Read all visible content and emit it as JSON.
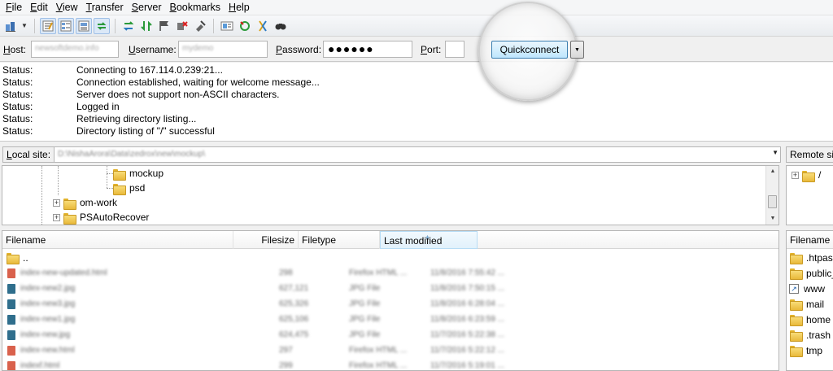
{
  "menu": [
    "File",
    "Edit",
    "View",
    "Transfer",
    "Server",
    "Bookmarks",
    "Help"
  ],
  "menu_accel": [
    "F",
    "E",
    "V",
    "T",
    "S",
    "B",
    "H"
  ],
  "menu_rest": [
    "ile",
    "dit",
    "iew",
    "ransfer",
    "erver",
    "ookmarks",
    "elp"
  ],
  "toolbar": {
    "icons": [
      "site-manager-icon",
      "toggle-message-log-icon",
      "toggle-local-tree-icon",
      "toggle-remote-tree-icon",
      "toggle-transfer-queue-icon",
      "refresh-icon",
      "process-queue-icon",
      "cancel-operation-icon",
      "disconnect-icon",
      "reconnect-icon",
      "directory-filter-icon",
      "sync-browsing-icon",
      "compare-dirs-icon",
      "search-icon"
    ]
  },
  "quickconnect": {
    "host_label_acc": "H",
    "host_label_rest": "ost:",
    "host_value": "newsoftdemo.info",
    "username_label_acc": "U",
    "username_label_rest": "sername:",
    "username_value": "mydemo",
    "password_label_acc": "P",
    "password_label_rest": "assword:",
    "password_value": "●●●●●●",
    "port_label_acc": "P",
    "port_label_rest": "ort:",
    "port_value": "",
    "button_label": "Quickconnect"
  },
  "log": [
    {
      "type": "Status:",
      "msg": "Connecting to 167.114.0.239:21..."
    },
    {
      "type": "Status:",
      "msg": "Connection established, waiting for welcome message..."
    },
    {
      "type": "Status:",
      "msg": "Server does not support non-ASCII characters."
    },
    {
      "type": "Status:",
      "msg": "Logged in"
    },
    {
      "type": "Status:",
      "msg": "Retrieving directory listing..."
    },
    {
      "type": "Status:",
      "msg": "Directory listing of \"/\" successful"
    }
  ],
  "local": {
    "label_acc": "L",
    "label_rest": "ocal site:",
    "path": "D:\\NishaArora\\Data\\zedrox\\new\\mockup\\",
    "tree": [
      "mockup",
      "psd",
      "om-work",
      "PSAutoRecover"
    ]
  },
  "remote": {
    "label": "Remote si",
    "tree_root": "/",
    "filename_header": "Filename",
    "files": [
      ".htpass",
      "public_",
      "www",
      "mail",
      "home",
      ".trash",
      "tmp"
    ]
  },
  "filelist": {
    "headers": {
      "filename": "Filename",
      "filesize": "Filesize",
      "filetype": "Filetype",
      "modified": "Last modified"
    },
    "parent": "..",
    "rows": [
      {
        "name": "index-new-updated.html",
        "size": "298",
        "type": "Firefox HTML ...",
        "date": "11/8/2016 7:55:42 ...",
        "color": "#d9614c"
      },
      {
        "name": "index-new2.jpg",
        "size": "627,121",
        "type": "JPG File",
        "date": "11/8/2016 7:50:15 ...",
        "color": "#2f6e8c"
      },
      {
        "name": "index-new3.jpg",
        "size": "625,326",
        "type": "JPG File",
        "date": "11/8/2016 6:28:04 ...",
        "color": "#2f6e8c"
      },
      {
        "name": "index-new1.jpg",
        "size": "625,106",
        "type": "JPG File",
        "date": "11/8/2016 6:23:59 ...",
        "color": "#2f6e8c"
      },
      {
        "name": "index-new.jpg",
        "size": "624,475",
        "type": "JPG File",
        "date": "11/7/2016 5:22:38 ...",
        "color": "#2f6e8c"
      },
      {
        "name": "index-new.html",
        "size": "297",
        "type": "Firefox HTML ...",
        "date": "11/7/2016 5:22:12 ...",
        "color": "#d9614c"
      },
      {
        "name": "indexf.html",
        "size": "299",
        "type": "Firefox HTML ...",
        "date": "11/7/2016 5:19:01 ...",
        "color": "#d9614c"
      }
    ]
  },
  "colors": {
    "accent": "#3c7fb1",
    "folder": "#e9b93a",
    "html_file": "#d9614c",
    "jpg_file": "#2f6e8c"
  }
}
